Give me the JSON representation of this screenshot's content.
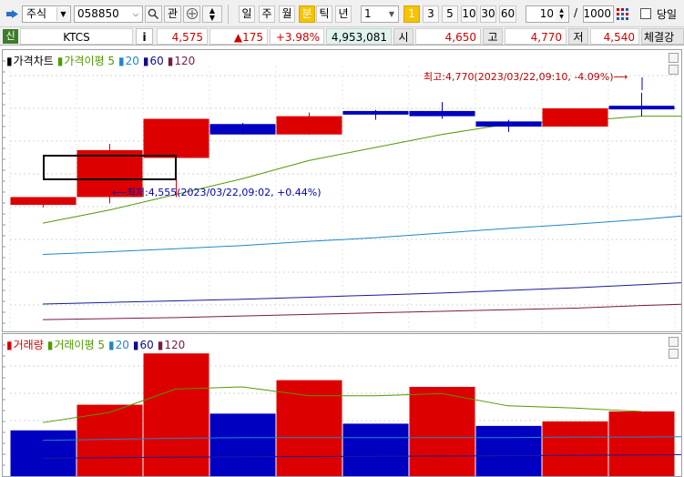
{
  "toolbar": {
    "menu_icon": "pin-icon",
    "market_type": "주식",
    "code": "058850",
    "search_icon": "search-icon",
    "interest_label": "관",
    "period_labels": [
      "일",
      "주",
      "월",
      "분",
      "틱",
      "년"
    ],
    "active_period": "분",
    "interval_value": "1",
    "quick_intervals": [
      "1",
      "3",
      "5",
      "10",
      "30",
      "60"
    ],
    "active_quick": "1",
    "count_value": "10",
    "total_value": "1000",
    "slash": "/",
    "today_label": "당일"
  },
  "quote": {
    "badge": "신",
    "name": "KTCS",
    "info_icon": "i",
    "price": "4,575",
    "change": "▲175",
    "change_pct": "+3.98%",
    "volume": "4,953,081",
    "open_label": "시",
    "open": "4,650",
    "high_label": "고",
    "high": "4,770",
    "low_label": "저",
    "low": "4,540",
    "strength_label": "체결강"
  },
  "price_pane": {
    "legend": [
      {
        "mark": "▮",
        "text": "가격차트",
        "color": "#000000"
      },
      {
        "mark": "▮",
        "text": "가격이평 5",
        "color": "#4f9a00"
      },
      {
        "mark": "▮",
        "text": "20",
        "color": "#1f87c8"
      },
      {
        "mark": "▮",
        "text": "60",
        "color": "#0d0d8a"
      },
      {
        "mark": "▮",
        "text": "120",
        "color": "#7a1848"
      }
    ],
    "high_annotation": "최고:4,770(2023/03/22,09:10, -4.09%)⟶",
    "low_annotation": "⟵최저:4,555(2023/03/22,09:02, +0.44%)"
  },
  "volume_pane": {
    "legend": [
      {
        "mark": "▮",
        "text": "거래량",
        "color": "#d40000"
      },
      {
        "mark": "▮",
        "text": "거래이평 5",
        "color": "#4f9a00"
      },
      {
        "mark": "▮",
        "text": "20",
        "color": "#1f87c8"
      },
      {
        "mark": "▮",
        "text": "60",
        "color": "#0d0d8a"
      },
      {
        "mark": "▮",
        "text": "120",
        "color": "#7a1848"
      }
    ]
  },
  "colors": {
    "up": "#dd0000",
    "down": "#0000c0",
    "ma5": "#4f9a00",
    "ma20": "#1f87c8",
    "ma60": "#1a1a9a",
    "ma120": "#7a1848",
    "up_text": "#d00000",
    "down_text": "#0000c8"
  },
  "chart_data": {
    "type": "candlestick",
    "candles": [
      {
        "open": 4555,
        "close": 4570,
        "high": 4560,
        "low": 4550,
        "dir": "up"
      },
      {
        "open": 4570,
        "close": 4660,
        "high": 4672,
        "low": 4558,
        "dir": "up"
      },
      {
        "open": 4645,
        "close": 4720,
        "high": 4720,
        "low": 4570,
        "dir": "up"
      },
      {
        "open": 4710,
        "close": 4690,
        "high": 4712,
        "low": 4690,
        "dir": "down"
      },
      {
        "open": 4690,
        "close": 4725,
        "high": 4732,
        "low": 4690,
        "dir": "up"
      },
      {
        "open": 4735,
        "close": 4730,
        "high": 4737,
        "low": 4718,
        "dir": "down"
      },
      {
        "open": 4735,
        "close": 4725,
        "high": 4752,
        "low": 4720,
        "dir": "down"
      },
      {
        "open": 4715,
        "close": 4705,
        "high": 4718,
        "low": 4695,
        "dir": "down"
      },
      {
        "open": 4705,
        "close": 4740,
        "high": 4740,
        "low": 4705,
        "dir": "up"
      },
      {
        "open": 4745,
        "close": 4740,
        "high": 4770,
        "low": 4725,
        "dir": "down"
      }
    ],
    "ma5": [
      4520,
      4545,
      4575,
      4605,
      4640,
      4665,
      4690,
      4710,
      4715,
      4725,
      4725
    ],
    "ma20": [
      4460,
      4465,
      4471,
      4477,
      4485,
      4492,
      4501,
      4510,
      4518,
      4527,
      4538
    ],
    "ma60": [
      4365,
      4368,
      4371,
      4374,
      4378,
      4382,
      4386,
      4391,
      4396,
      4402,
      4408
    ],
    "ma120": [
      4335,
      4337,
      4339,
      4342,
      4345,
      4348,
      4351,
      4354,
      4357,
      4362,
      4366
    ],
    "volume": [
      410,
      640,
      1100,
      560,
      860,
      470,
      800,
      450,
      490,
      580
    ],
    "volume_dir": [
      "down",
      "up",
      "up",
      "down",
      "up",
      "down",
      "up",
      "down",
      "up",
      "up"
    ],
    "vol_ma5": [
      480,
      570,
      780,
      800,
      720,
      720,
      740,
      630,
      610,
      580
    ],
    "vol_ma20": [
      320,
      330,
      340,
      345,
      345,
      345,
      345,
      345,
      350,
      350,
      355
    ],
    "vol_ma60": [
      160,
      165,
      170,
      172,
      175,
      178,
      180,
      183,
      186,
      190,
      193
    ]
  }
}
